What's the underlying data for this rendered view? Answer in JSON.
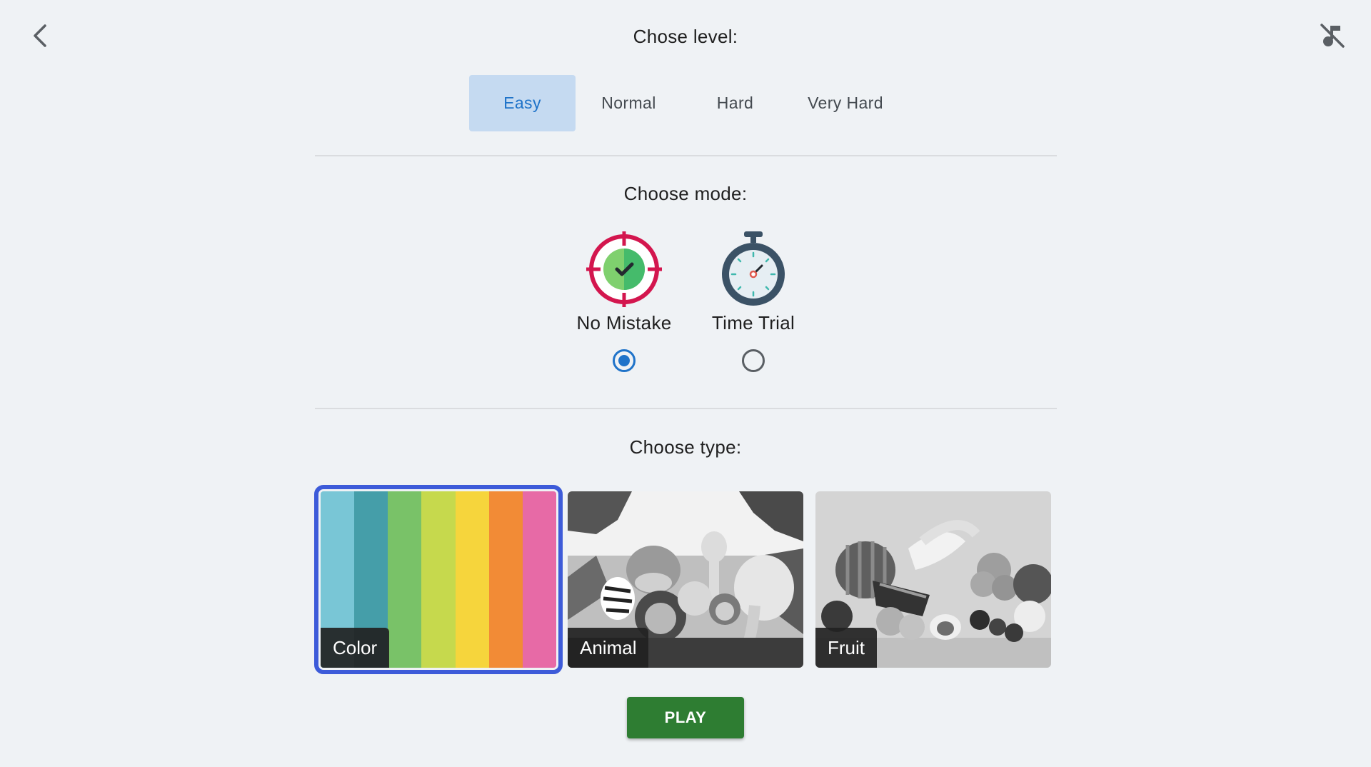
{
  "header": {
    "back_icon": "chevron-left-icon",
    "mute_icon": "music-off-icon",
    "level_title": "Chose level:"
  },
  "levels": [
    {
      "label": "Easy",
      "selected": true
    },
    {
      "label": "Normal",
      "selected": false
    },
    {
      "label": "Hard",
      "selected": false
    },
    {
      "label": "Very Hard",
      "selected": false
    }
  ],
  "mode": {
    "title": "Choose mode:",
    "options": [
      {
        "label": "No Mistake",
        "icon": "target-check-icon",
        "selected": true
      },
      {
        "label": "Time Trial",
        "icon": "stopwatch-icon",
        "selected": false
      }
    ]
  },
  "type": {
    "title": "Choose type:",
    "options": [
      {
        "label": "Color",
        "image": "color-stripes",
        "selected": true
      },
      {
        "label": "Animal",
        "image": "jungle-animals-image",
        "selected": false
      },
      {
        "label": "Fruit",
        "image": "fruit-pile-image",
        "selected": false
      }
    ]
  },
  "play_label": "PLAY",
  "colors": {
    "accent": "#1f73c9",
    "active_tab_bg": "#c5daf1",
    "selected_outline": "#3d5bd9",
    "play_button": "#2e7d32",
    "background": "#eff2f5",
    "color_stripes": [
      "#79c6d6",
      "#459ea9",
      "#79c268",
      "#c6d94d",
      "#f6d53c",
      "#f28b36",
      "#e76aa6"
    ]
  }
}
